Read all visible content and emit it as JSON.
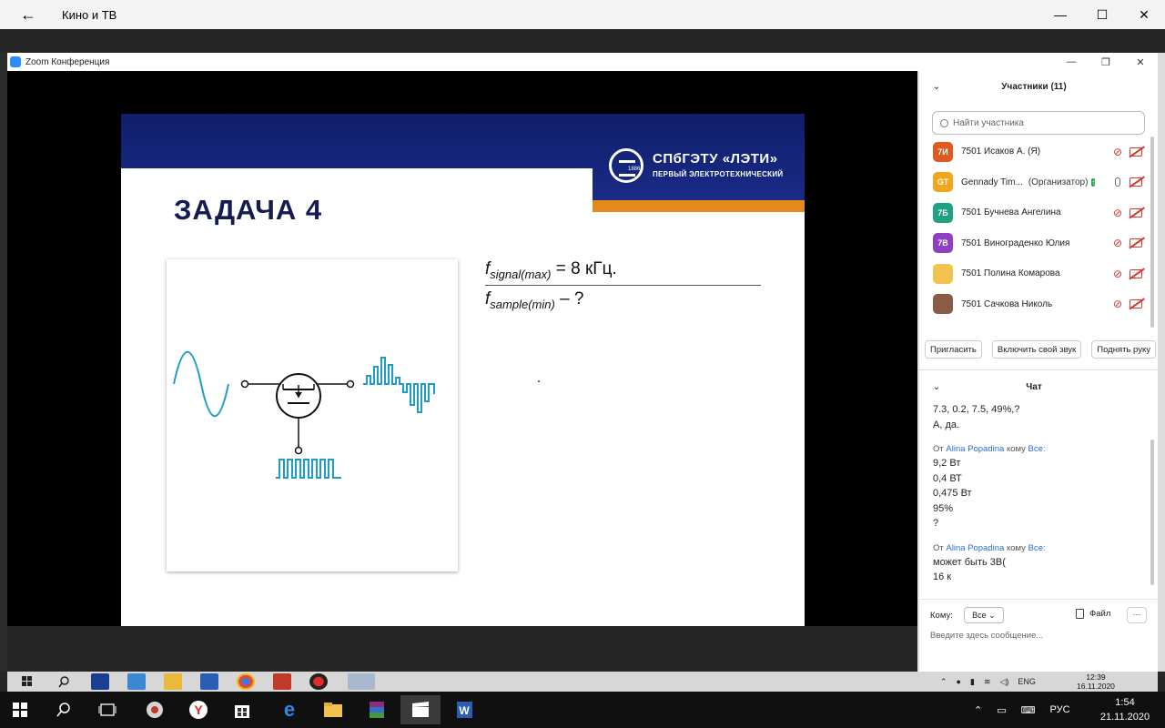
{
  "outer_window": {
    "title": "Кино и ТВ",
    "back_glyph": "←",
    "min_glyph": "—",
    "max_glyph": "☐",
    "close_glyph": "✕"
  },
  "zoom_window": {
    "title": "Zoom Конференция",
    "min_glyph": "—",
    "restore_glyph": "❐",
    "close_glyph": "✕"
  },
  "slide": {
    "title": "ЗАДАЧА 4",
    "logo_line1": "СПбГЭТУ «ЛЭТИ»",
    "logo_line2": "ПЕРВЫЙ ЭЛЕКТРОТЕХНИЧЕСКИЙ",
    "logo_year": "1886",
    "formula1": {
      "var": "f",
      "sub": "signal(max)",
      "rest": " = 8 кГц."
    },
    "formula2": {
      "var": "f",
      "sub": "sample(min)",
      "rest": " – ?"
    }
  },
  "participants": {
    "header": "Участники (11)",
    "search_placeholder": "Найти участника",
    "items": [
      {
        "initials": "7И",
        "color": "#e05a1f",
        "name": "7501 Исаков А. (Я)",
        "mic": "off",
        "cam": "off"
      },
      {
        "initials": "GT",
        "color": "#f0a71c",
        "name": "Gennady Tim...",
        "role": "(Организатор)",
        "mic": "on",
        "cam": "off",
        "sharing": true
      },
      {
        "initials": "7Б",
        "color": "#21a184",
        "name": "7501 Бучнева Ангелина",
        "mic": "off",
        "cam": "off"
      },
      {
        "initials": "7В",
        "color": "#8e3fc6",
        "name": "7501 Винограденко Юлия",
        "mic": "off",
        "cam": "off"
      },
      {
        "initials": "",
        "color": "#f2c34e",
        "name": "7501 Полина Комарова",
        "mic": "off",
        "cam": "off",
        "photo": true
      },
      {
        "initials": "",
        "color": "#8a5b45",
        "name": "7501 Сачкова Николь",
        "mic": "off",
        "cam": "off",
        "photo": true
      }
    ],
    "buttons": {
      "invite": "Пригласить",
      "unmute": "Включить свой звук",
      "raise_hand": "Поднять руку"
    }
  },
  "chat": {
    "header": "Чат",
    "messages": [
      {
        "lines": [
          "7.3, 0.2, 7.5, 49%,?",
          "А, да."
        ]
      },
      {
        "from_prefix": "От",
        "sender": "Alina Popadina",
        "to_word": "кому",
        "recipient": "Все:",
        "lines": [
          "9,2 Вт",
          "0,4 ВТ",
          "0,475 Вт",
          "95%",
          "?"
        ]
      },
      {
        "from_prefix": "От",
        "sender": "Alina Popadina",
        "to_word": "кому",
        "recipient": "Все:",
        "lines": [
          "может быть 3В(",
          "16 к"
        ]
      }
    ],
    "to_label": "Кому:",
    "to_value": "Все",
    "file_label": "Файл",
    "more_label": "···",
    "input_placeholder": "Введите здесь сообщение..."
  },
  "remote_taskbar": {
    "lang": "ENG",
    "time": "12:39",
    "date": "16.11.2020"
  },
  "taskbar": {
    "lang": "РУС",
    "time": "1:54",
    "date": "21.11.2020"
  }
}
